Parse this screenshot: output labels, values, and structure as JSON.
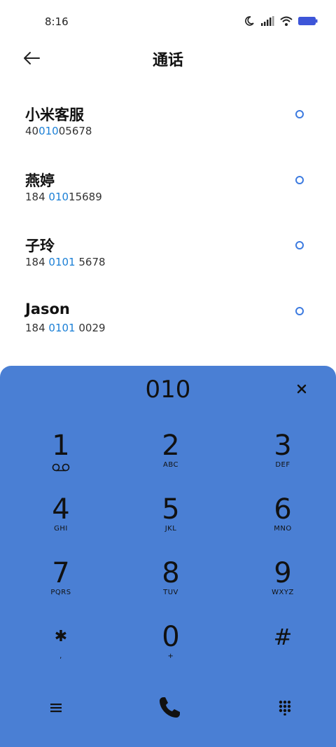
{
  "status": {
    "time": "8:16"
  },
  "header": {
    "title": "通话"
  },
  "contacts": [
    {
      "name": "小米客服",
      "num_pre": "40",
      "num_hl": "010",
      "num_post": "05678"
    },
    {
      "name": "燕婷",
      "num_pre": "184 ",
      "num_hl": "010",
      "num_post": "15689"
    },
    {
      "name": "子玲",
      "num_pre": "184 ",
      "num_hl": "0101",
      "num_post": " 5678"
    },
    {
      "name": "Jason",
      "num_pre": "184 ",
      "num_hl": "0101",
      "num_post": " 0029"
    }
  ],
  "dialpad": {
    "entry": "010",
    "keys": [
      {
        "digit": "1",
        "letters": ""
      },
      {
        "digit": "2",
        "letters": "ABC"
      },
      {
        "digit": "3",
        "letters": "DEF"
      },
      {
        "digit": "4",
        "letters": "GHI"
      },
      {
        "digit": "5",
        "letters": "JKL"
      },
      {
        "digit": "6",
        "letters": "MNO"
      },
      {
        "digit": "7",
        "letters": "PQRS"
      },
      {
        "digit": "8",
        "letters": "TUV"
      },
      {
        "digit": "9",
        "letters": "WXYZ"
      },
      {
        "digit": "✱",
        "letters": ","
      },
      {
        "digit": "0",
        "letters": "+"
      },
      {
        "digit": "#",
        "letters": ""
      }
    ]
  },
  "colors": {
    "accent": "#1a7fd6",
    "dialpad_bg": "#4a7fd4"
  }
}
